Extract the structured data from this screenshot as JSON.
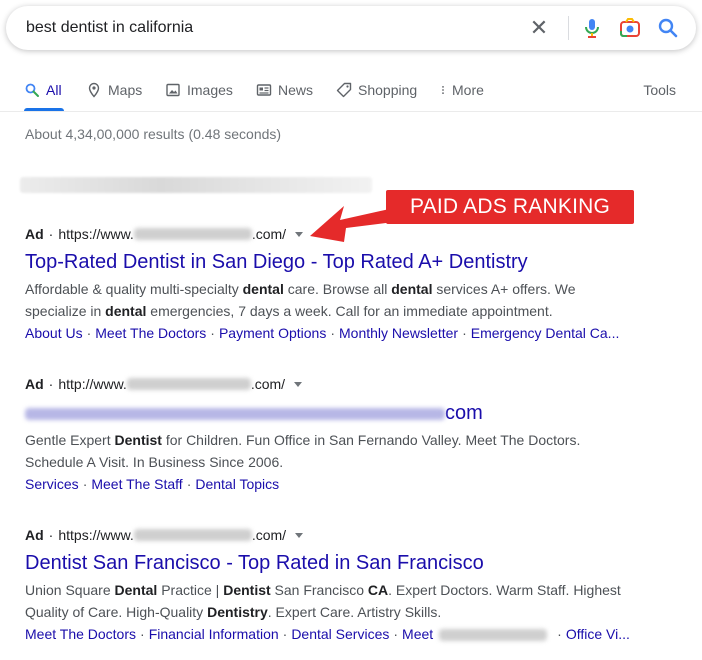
{
  "search": {
    "query": "best dentist in california"
  },
  "tabs": [
    {
      "label": "All",
      "icon": "search-icon",
      "active": true
    },
    {
      "label": "Maps",
      "icon": "map-pin-icon"
    },
    {
      "label": "Images",
      "icon": "image-icon"
    },
    {
      "label": "News",
      "icon": "news-icon"
    },
    {
      "label": "Shopping",
      "icon": "tag-icon"
    },
    {
      "label": "More",
      "icon": "more-vert-icon"
    }
  ],
  "tools_label": "Tools",
  "stats": "About 4,34,00,000 results (0.48 seconds)",
  "callout": "PAID ADS RANKING",
  "results": [
    {
      "ad_label": "Ad",
      "url_prefix": "https://www.",
      "url_suffix": ".com/",
      "title": "Top-Rated Dentist in San Diego - Top Rated A+ Dentistry",
      "snippet_parts": [
        [
          "Affordable & quality multi-specialty ",
          false
        ],
        [
          "dental",
          true
        ],
        [
          " care. Browse all ",
          false
        ],
        [
          "dental",
          true
        ],
        [
          " services A+ offers. We specialize in ",
          false
        ],
        [
          "dental",
          true
        ],
        [
          " emergencies, 7 days a week. Call for an immediate appointment.",
          false
        ]
      ],
      "sitelinks": [
        "About Us",
        "Meet The Doctors",
        "Payment Options",
        "Monthly Newsletter",
        "Emergency Dental Ca..."
      ]
    },
    {
      "ad_label": "Ad",
      "url_prefix": "http://www.",
      "url_suffix": ".com/",
      "title_suffix": "com",
      "snippet_parts": [
        [
          "Gentle Expert ",
          false
        ],
        [
          "Dentist",
          true
        ],
        [
          " for Children. Fun Office in San Fernando Valley. Meet The Doctors. Schedule A Visit. In Business Since 2006.",
          false
        ]
      ],
      "sitelinks": [
        "Services",
        "Meet The Staff",
        "Dental Topics"
      ]
    },
    {
      "ad_label": "Ad",
      "url_prefix": "https://www.",
      "url_suffix": ".com/",
      "title": "Dentist San Francisco - Top Rated in San Francisco",
      "snippet_parts": [
        [
          "Union Square ",
          false
        ],
        [
          "Dental",
          true
        ],
        [
          " Practice | ",
          false
        ],
        [
          "Dentist",
          true
        ],
        [
          " San Francisco ",
          false
        ],
        [
          "CA",
          true
        ],
        [
          ". Expert Doctors. Warm Staff. Highest Quality of Care. High-Quality ",
          false
        ],
        [
          "Dentistry",
          true
        ],
        [
          ". Expert Care. Artistry Skills.",
          false
        ]
      ],
      "sitelinks": [
        "Meet The Doctors",
        "Financial Information",
        "Dental Services",
        "Meet",
        "Office Vi..."
      ]
    }
  ],
  "colors": {
    "link": "#1a0dab",
    "accent": "#1a73e8",
    "callout_bg": "#e52a2a"
  }
}
